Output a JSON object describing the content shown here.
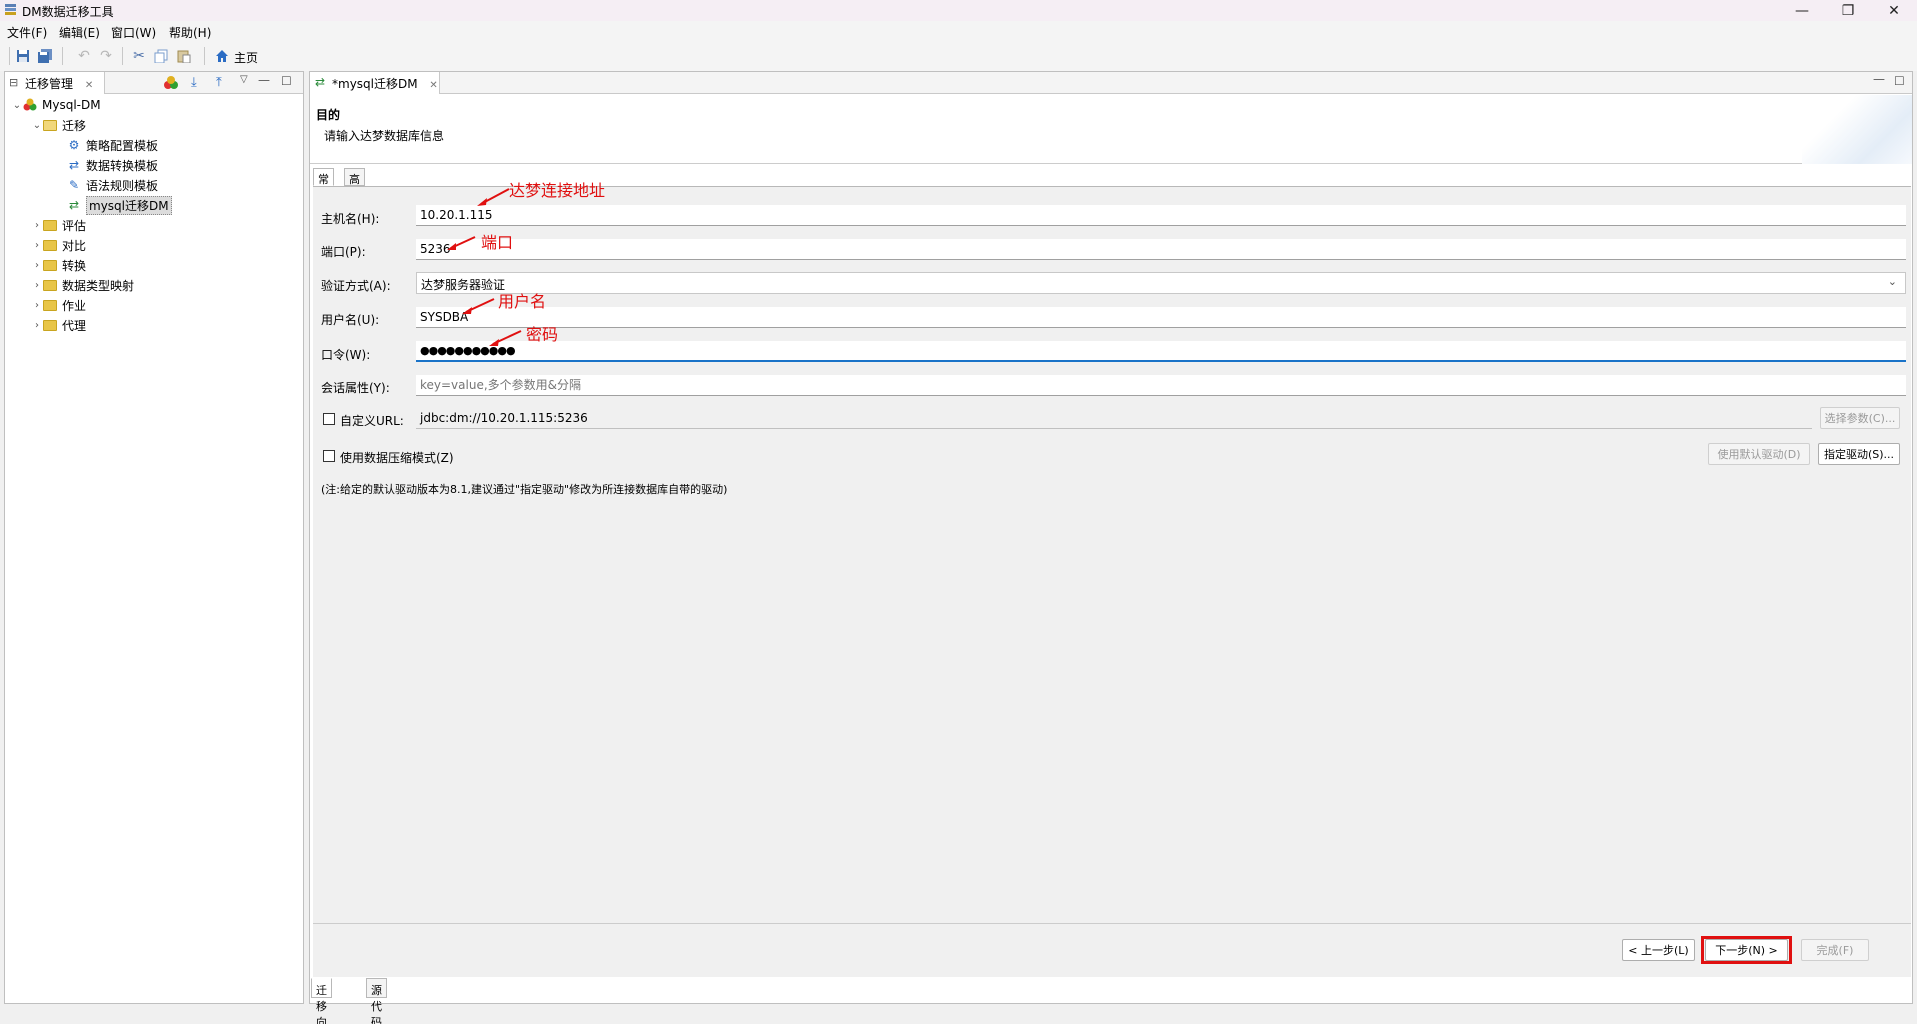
{
  "window": {
    "title": "DM数据迁移工具"
  },
  "menu": [
    "文件(F)",
    "编辑(E)",
    "窗口(W)",
    "帮助(H)"
  ],
  "toolbar": {
    "home_label": "主页"
  },
  "left_panel": {
    "tab_label": "迁移管理",
    "tree": {
      "root": "Mysql-DM",
      "migration_folder": "迁移",
      "migration_children": [
        "策略配置模板",
        "数据转换模板",
        "语法规则模板",
        "mysql迁移DM"
      ],
      "folders": [
        "评估",
        "对比",
        "转换",
        "数据类型映射",
        "作业",
        "代理"
      ]
    }
  },
  "editor": {
    "tab_label": "*mysql迁移DM",
    "header_title": "目的",
    "header_desc": "请输入达梦数据库信息",
    "inner_tabs": [
      "常规",
      "高级"
    ],
    "form": {
      "host_label": "主机名(H):",
      "host_value": "10.20.1.115",
      "port_label": "端口(P):",
      "port_value": "5236",
      "auth_label": "验证方式(A):",
      "auth_value": "达梦服务器验证",
      "user_label": "用户名(U):",
      "user_value": "SYSDBA",
      "password_label": "口令(W):",
      "password_value": "●●●●●●●●●●●",
      "session_label": "会话属性(Y):",
      "session_placeholder": "key=value,多个参数用&分隔",
      "custom_url_label": "自定义URL:",
      "custom_url_value": "jdbc:dm://10.20.1.115:5236",
      "select_params_button": "选择参数(C)...",
      "compress_label": "使用数据压缩模式(Z)",
      "default_driver_button": "使用默认驱动(D)",
      "specify_driver_button": "指定驱动(S)...",
      "note": "(注:给定的默认驱动版本为8.1,建议通过\"指定驱动\"修改为所连接数据库自带的驱动)"
    },
    "annotations": {
      "host": "达梦连接地址",
      "port": "端口",
      "user": "用户名",
      "password": "密码"
    },
    "nav": {
      "prev": "< 上一步(L)",
      "next": "下一步(N) >",
      "finish": "完成(F)"
    },
    "bottom_tabs": [
      "迁移向导",
      "源代码"
    ]
  },
  "colors": {
    "annotation": "#e01010",
    "highlight_box": "#e01010",
    "focus_underline": "#1a73c8"
  }
}
